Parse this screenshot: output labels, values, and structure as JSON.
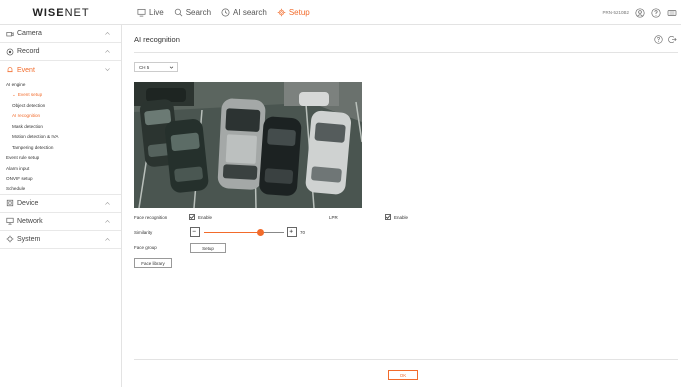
{
  "brand": {
    "logo_bold": "WISE",
    "logo_thin": "NET"
  },
  "nav": {
    "items": [
      {
        "label": "Live",
        "icon": "monitor-icon",
        "active": false
      },
      {
        "label": "Search",
        "icon": "search-icon",
        "active": false
      },
      {
        "label": "AI search",
        "icon": "ai-search-icon",
        "active": false
      },
      {
        "label": "Setup",
        "icon": "gear-icon",
        "active": true
      }
    ],
    "device_name": "PRN-5210B2",
    "accent": "#f26b2b"
  },
  "sidebar": {
    "camera": "Camera",
    "record": "Record",
    "event": "Event",
    "event_items": {
      "ai_engine": "AI engine",
      "event_setup": "Event setup",
      "object_detection": "Object detection",
      "ai_recognition": "AI recognition",
      "mask_detection": "Mask detection",
      "motion_detection": "Motion detection & IVA",
      "tampering_detection": "Tampering detection",
      "event_rule_setup": "Event rule setup",
      "alarm_input": "Alarm input",
      "onvif_setup": "ONVIF setup",
      "schedule": "Schedule"
    },
    "device": "Device",
    "network": "Network",
    "system": "System"
  },
  "page": {
    "title": "AI recognition",
    "channel": "CH 5",
    "face_recognition_label": "Face recognition",
    "face_recognition_enable": "Enable",
    "face_recognition_checked": true,
    "lpr_label": "LPR",
    "lpr_enable": "Enable",
    "lpr_checked": true,
    "similarity_label": "Similarity",
    "similarity_value": "70",
    "similarity_fraction": 0.7,
    "face_group_label": "Face group",
    "face_group_button": "Setup",
    "face_library_button": "Face library",
    "ok_button": "OK"
  }
}
